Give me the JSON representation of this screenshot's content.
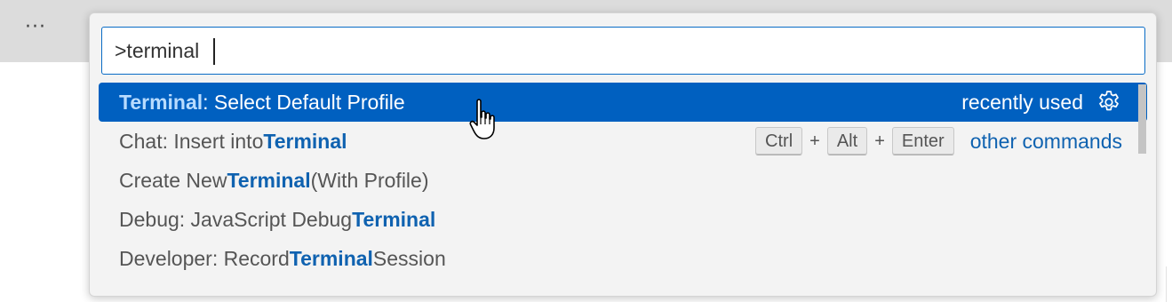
{
  "window": {
    "more_actions_label": "···"
  },
  "command_palette": {
    "input_value": ">terminal",
    "results": [
      {
        "highlight": "Terminal",
        "after": ": Select Default Profile",
        "meta": "recently used",
        "selected": true
      },
      {
        "before": "Chat: Insert into ",
        "highlight": "Terminal",
        "keybinding": [
          "Ctrl",
          "Alt",
          "Enter"
        ],
        "keybinding_separator": "+",
        "group_label": "other commands"
      },
      {
        "before": "Create New ",
        "highlight": "Terminal",
        "after": " (With Profile)"
      },
      {
        "before": "Debug: JavaScript Debug ",
        "highlight": "Terminal"
      },
      {
        "before": "Developer: Record ",
        "highlight": "Terminal",
        "after": " Session"
      }
    ]
  },
  "colors": {
    "selection_bg": "#0060c0",
    "highlight_text": "#0f62b0",
    "input_border": "#0a6cc5"
  },
  "icons": {
    "configure": "gear-icon",
    "pointer": "hand-cursor-icon"
  }
}
